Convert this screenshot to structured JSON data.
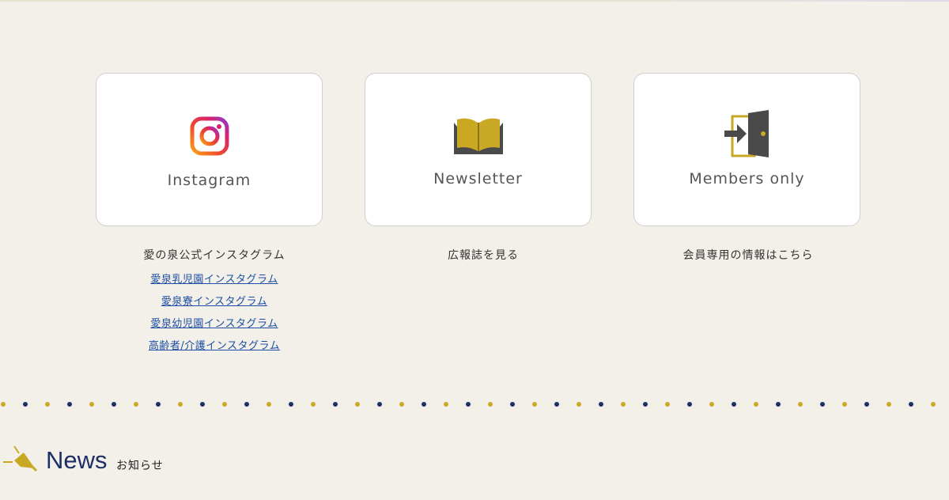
{
  "cards": [
    {
      "label": "Instagram",
      "icon": "instagram-icon",
      "description": "愛の泉公式インスタグラム",
      "links": [
        "愛泉乳児園インスタグラム",
        "愛泉寮インスタグラム",
        "愛泉幼児園インスタグラム",
        "高齢者/介護インスタグラム"
      ]
    },
    {
      "label": "Newsletter",
      "icon": "open-book-icon",
      "description": "広報誌を見る"
    },
    {
      "label": "Members only",
      "icon": "door-enter-icon",
      "description": "会員専用の情報はこちら"
    }
  ],
  "news": {
    "title": "News",
    "subtitle": "お知らせ",
    "icon": "megaphone-icon"
  },
  "colors": {
    "background": "#f2f0e9",
    "gold": "#c9a824",
    "navy": "#1c2f66",
    "link": "#1d4ea3"
  }
}
